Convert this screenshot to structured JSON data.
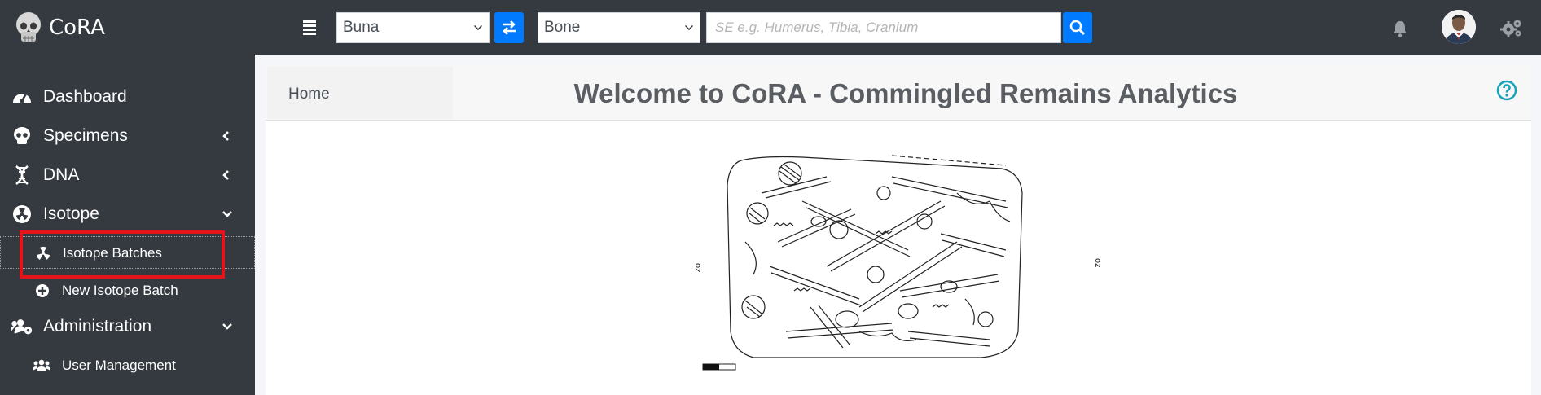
{
  "app": {
    "name": "CoRA"
  },
  "navbar": {
    "site_select": {
      "value": "Buna"
    },
    "bone_select": {
      "value": "Bone"
    },
    "search": {
      "placeholder": "SE e.g. Humerus, Tibia, Cranium",
      "value": ""
    }
  },
  "sidebar": {
    "items": [
      {
        "label": "Dashboard",
        "icon": "tachometer-icon"
      },
      {
        "label": "Specimens",
        "icon": "skull-icon",
        "chevron": "left"
      },
      {
        "label": "DNA",
        "icon": "dna-icon",
        "chevron": "left"
      },
      {
        "label": "Isotope",
        "icon": "radiation-icon",
        "chevron": "down"
      },
      {
        "label": "Isotope Batches",
        "icon": "radiation-icon",
        "sub": true,
        "active": true
      },
      {
        "label": "New Isotope Batch",
        "icon": "plus-circle-icon",
        "sub": true
      },
      {
        "label": "Administration",
        "icon": "users-cog-icon",
        "chevron": "down"
      },
      {
        "label": "User Management",
        "icon": "users-icon",
        "sub": true
      }
    ]
  },
  "breadcrumb": {
    "home": "Home"
  },
  "main": {
    "title": "Welcome to CoRA - Commingled Remains Analytics"
  },
  "colors": {
    "navbar": "#343a40",
    "accent": "#007bff",
    "highlight": "#e3151a",
    "help": "#17a2b8"
  }
}
